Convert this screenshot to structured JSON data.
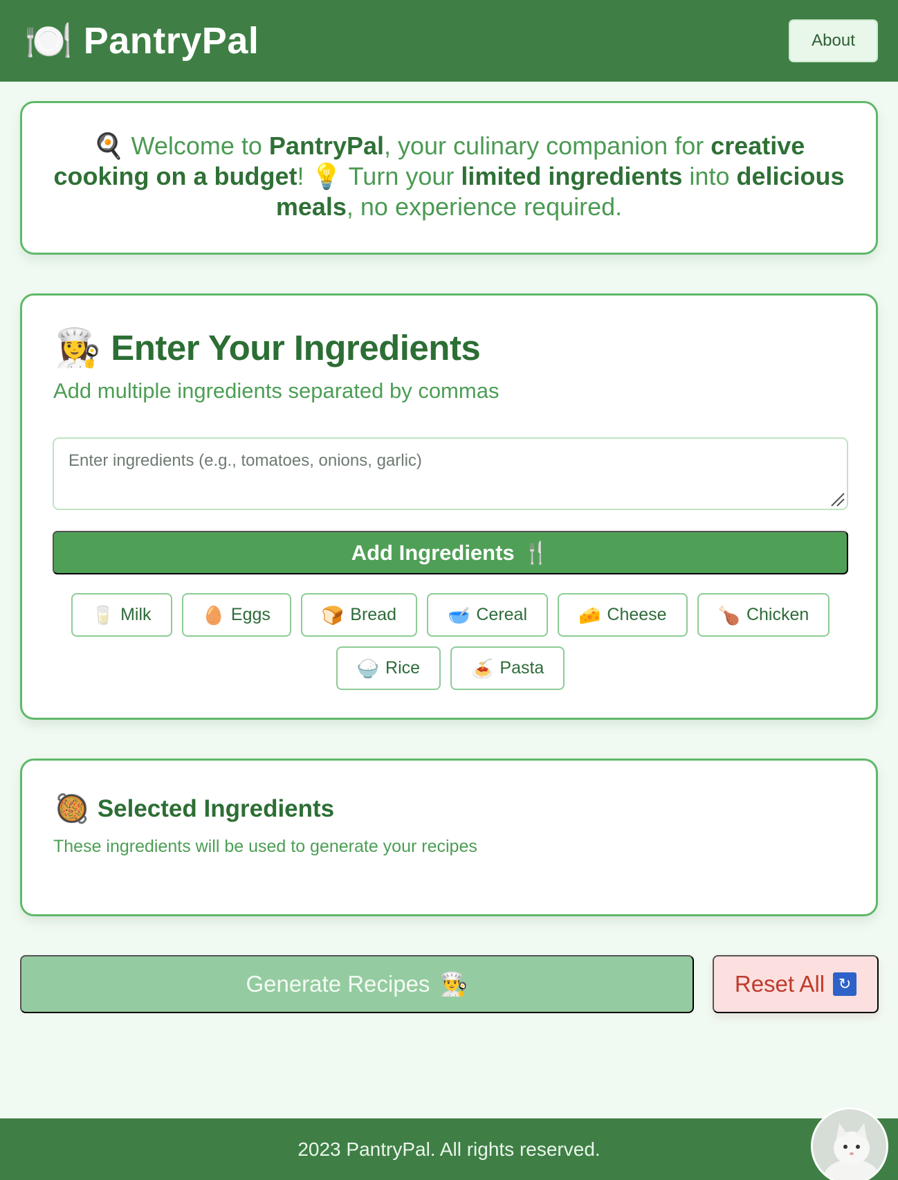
{
  "header": {
    "brand_icon": "🍽️",
    "brand_name": "PantryPal",
    "about_label": "About"
  },
  "welcome": {
    "icon": "🍳",
    "parts": {
      "a": "Welcome to ",
      "b": "PantryPal",
      "c": ", your culinary companion for ",
      "d": "creative cooking on a budget",
      "e": "! ",
      "bulb": "💡",
      "f": " Turn your ",
      "g": "limited ingredients",
      "h": " into ",
      "i": "delicious meals",
      "j": ", no experience required."
    }
  },
  "ingredients": {
    "title_icon": "👩‍🍳",
    "title": "Enter Your Ingredients",
    "subtitle": "Add multiple ingredients separated by commas",
    "input_placeholder": "Enter ingredients (e.g., tomatoes, onions, garlic)",
    "input_value": "",
    "add_label": "Add Ingredients",
    "add_icon": "🍴",
    "chips": [
      {
        "icon": "🥛",
        "label": "Milk"
      },
      {
        "icon": "🥚",
        "label": "Eggs"
      },
      {
        "icon": "🍞",
        "label": "Bread"
      },
      {
        "icon": "🥣",
        "label": "Cereal"
      },
      {
        "icon": "🧀",
        "label": "Cheese"
      },
      {
        "icon": "🍗",
        "label": "Chicken"
      },
      {
        "icon": "🍚",
        "label": "Rice"
      },
      {
        "icon": "🍝",
        "label": "Pasta"
      }
    ]
  },
  "selected": {
    "icon": "🥘",
    "title": "Selected Ingredients",
    "subtitle": "These ingredients will be used to generate your recipes"
  },
  "actions": {
    "generate_label": "Generate Recipes",
    "generate_icon": "👨‍🍳",
    "reset_label": "Reset All",
    "reset_icon": "🔄"
  },
  "footer": {
    "text": "2023 PantryPal. All rights reserved."
  },
  "colors": {
    "header_bg": "#3f7f45",
    "accent": "#4fa056",
    "card_border": "#5fb86a",
    "reset_text": "#c03a2b",
    "page_bg": "#f1faf2"
  }
}
